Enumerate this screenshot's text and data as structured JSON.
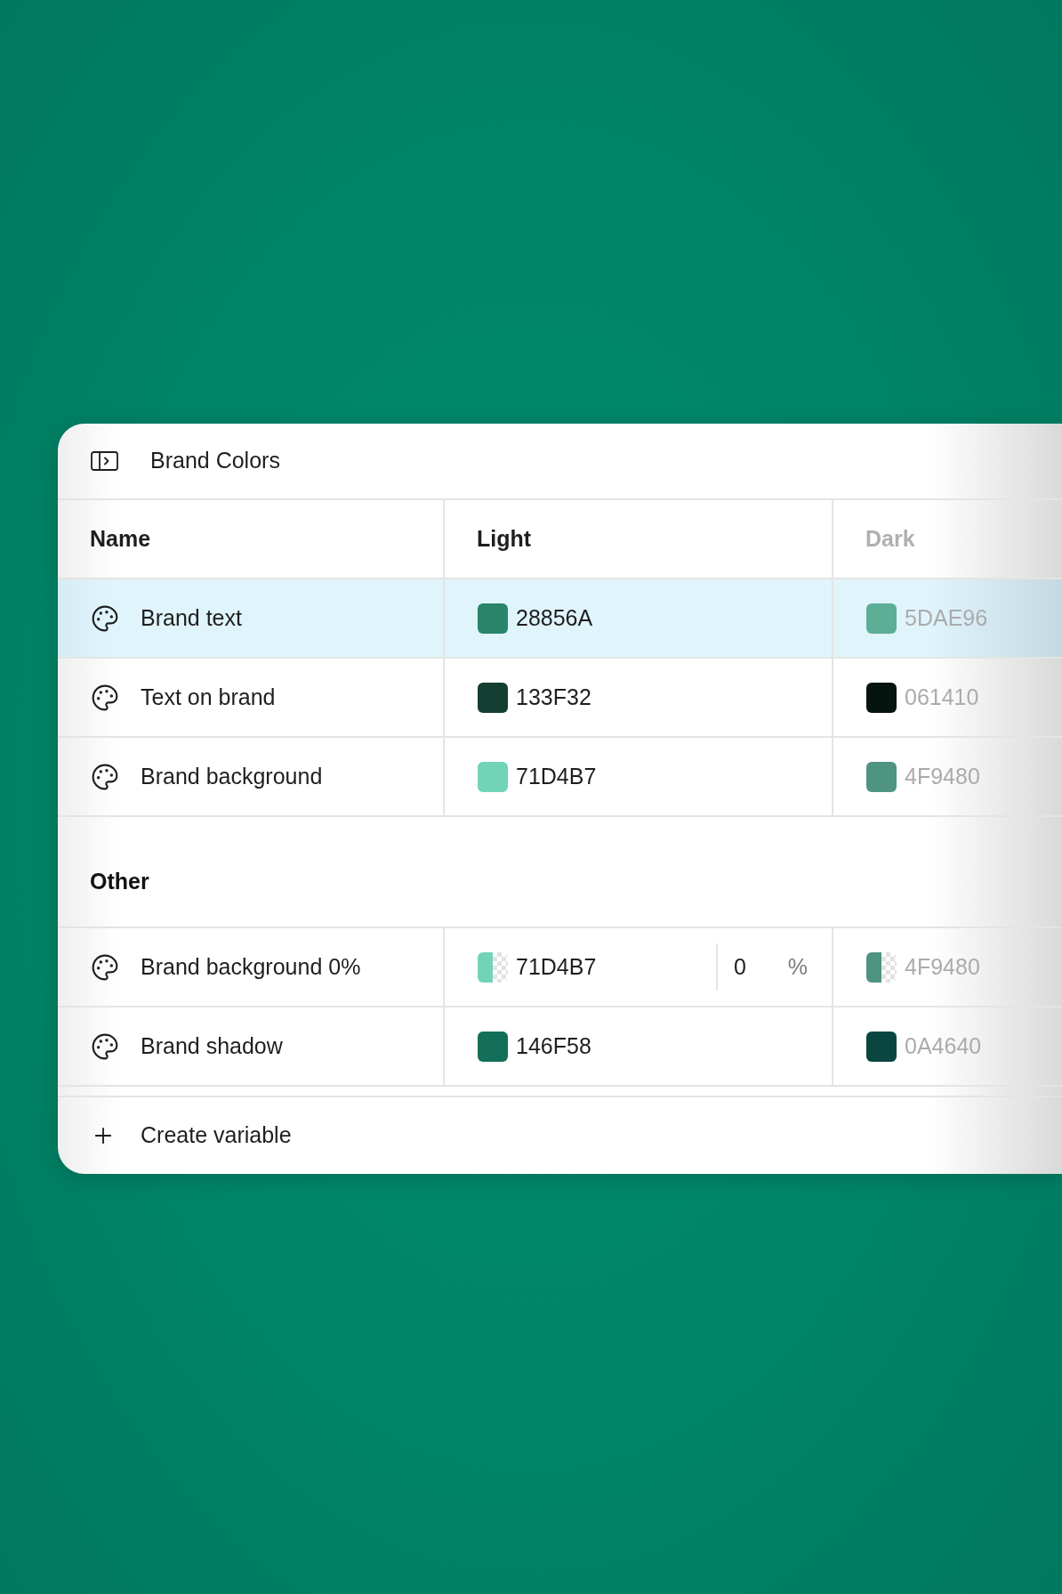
{
  "panel": {
    "title": "Brand Colors"
  },
  "table": {
    "columns": [
      {
        "label": "Name",
        "muted": false
      },
      {
        "label": "Light",
        "muted": false
      },
      {
        "label": "Dark",
        "muted": true
      }
    ],
    "groups": [
      {
        "rows": [
          {
            "name": "Brand text",
            "selected": true,
            "values": [
              {
                "kind": "solid",
                "color": "#28856a",
                "hex": "28856A"
              },
              {
                "kind": "solid",
                "color": "#5dae96",
                "hex": "5DAE96"
              }
            ]
          },
          {
            "name": "Text on brand",
            "selected": false,
            "values": [
              {
                "kind": "solid",
                "color": "#133f32",
                "hex": "133F32"
              },
              {
                "kind": "solid",
                "color": "#061410",
                "hex": "061410"
              }
            ]
          },
          {
            "name": "Brand background",
            "selected": false,
            "values": [
              {
                "kind": "solid",
                "color": "#71d4b7",
                "hex": "71D4B7"
              },
              {
                "kind": "solid",
                "color": "#4f9480",
                "hex": "4F9480"
              }
            ]
          }
        ]
      },
      {
        "title": "Other",
        "rows": [
          {
            "name": "Brand background 0%",
            "selected": false,
            "values": [
              {
                "kind": "transparent",
                "color": "#71d4b7",
                "hex": "71D4B7",
                "alpha": "0",
                "unit": "%"
              },
              {
                "kind": "transparent",
                "color": "#4f9480",
                "hex": "4F9480"
              }
            ]
          },
          {
            "name": "Brand shadow",
            "selected": false,
            "values": [
              {
                "kind": "solid",
                "color": "#146f58",
                "hex": "146F58"
              },
              {
                "kind": "solid",
                "color": "#0a4640",
                "hex": "0A4640"
              }
            ]
          }
        ]
      }
    ]
  },
  "footer": {
    "button": "Create variable"
  }
}
